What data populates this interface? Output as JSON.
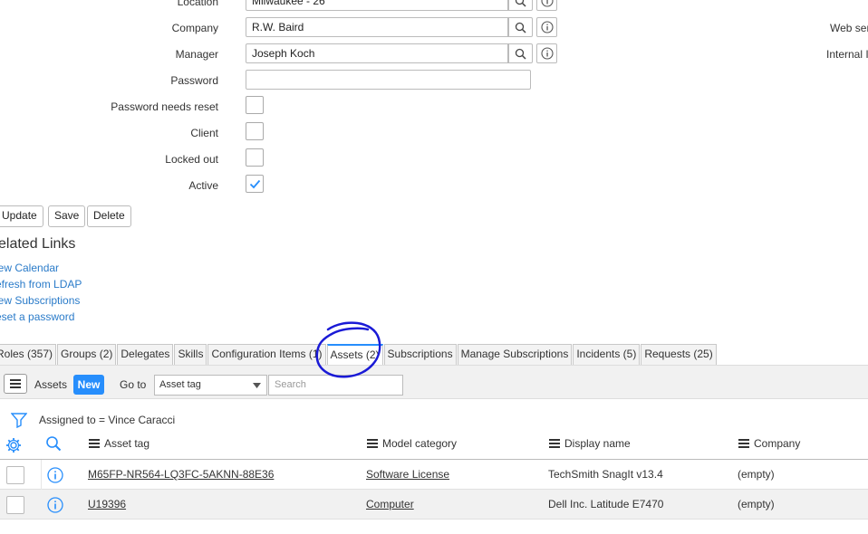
{
  "form": {
    "location_label": "Location",
    "location_value": "Milwaukee - 26",
    "company_label": "Company",
    "company_value": "R.W. Baird",
    "manager_label": "Manager",
    "manager_value": "Joseph Koch",
    "password_label": "Password",
    "password_reset_label": "Password needs reset",
    "client_label": "Client",
    "locked_out_label": "Locked out",
    "active_label": "Active",
    "active_checked": true,
    "right_label_1": "Web serv",
    "right_label_2": "Internal I"
  },
  "actions": {
    "update": "Update",
    "save": "Save",
    "delete": "Delete"
  },
  "related": {
    "title": "elated Links",
    "links": [
      "iew Calendar",
      "efresh from LDAP",
      "iew Subscriptions",
      "eset a password"
    ]
  },
  "tabs": [
    "Roles (357)",
    "Groups (2)",
    "Delegates",
    "Skills",
    "Configuration Items (1)",
    "Assets (2)",
    "Subscriptions",
    "Manage Subscriptions",
    "Incidents (5)",
    "Requests (25)"
  ],
  "active_tab_index": 5,
  "list": {
    "title": "Assets",
    "new_label": "New",
    "goto_label": "Go to",
    "goto_select": "Asset tag",
    "search_placeholder": "Search",
    "filter_text": "Assigned to = Vince Caracci",
    "columns": [
      "Asset tag",
      "Model category",
      "Display name",
      "Company"
    ],
    "rows": [
      {
        "asset_tag": "M65FP-NR564-LQ3FC-5AKNN-88E36",
        "model_category": "Software License",
        "display_name": "TechSmith SnagIt v13.4",
        "company": "(empty)"
      },
      {
        "asset_tag": "U19396",
        "model_category": "Computer",
        "display_name": "Dell Inc. Latitude E7470",
        "company": "(empty)"
      }
    ]
  },
  "colors": {
    "accent": "#278efc",
    "link": "#2a7bc9",
    "annotation": "#1a1ad6"
  }
}
